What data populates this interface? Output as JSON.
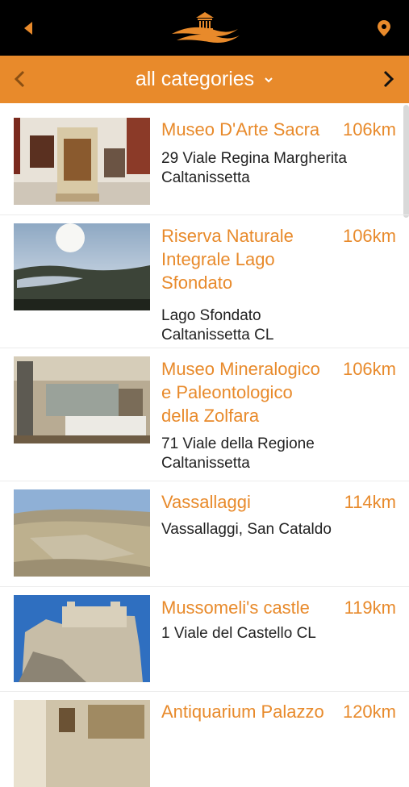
{
  "header": {
    "back_icon": "back-arrow-icon",
    "logo_icon": "temple-logo-icon",
    "location_icon": "map-pin-icon",
    "accent_color": "#e88a2b"
  },
  "category_bar": {
    "label": "all categories",
    "prev_icon": "chevron-left-icon",
    "next_icon": "chevron-right-icon",
    "caret_icon": "chevron-down-icon"
  },
  "places": [
    {
      "name": "Museo D'Arte Sacra",
      "distance": "106km",
      "address": "29 Viale Regina Margherita Caltanissetta"
    },
    {
      "name": "Riserva Naturale Integrale Lago Sfondato",
      "distance": "106km",
      "address": "Lago Sfondato Caltanissetta CL"
    },
    {
      "name": "Museo Mineralogico e Paleontologico della Zolfara",
      "distance": "106km",
      "address": "71 Viale della Regione Caltanissetta"
    },
    {
      "name": "Vassallaggi",
      "distance": "114km",
      "address": "Vassallaggi, San Cataldo"
    },
    {
      "name": "Mussomeli's castle",
      "distance": "119km",
      "address": "1 Viale del Castello CL"
    },
    {
      "name": "Antiquarium Palazzo",
      "distance": "120km",
      "address": ""
    }
  ]
}
